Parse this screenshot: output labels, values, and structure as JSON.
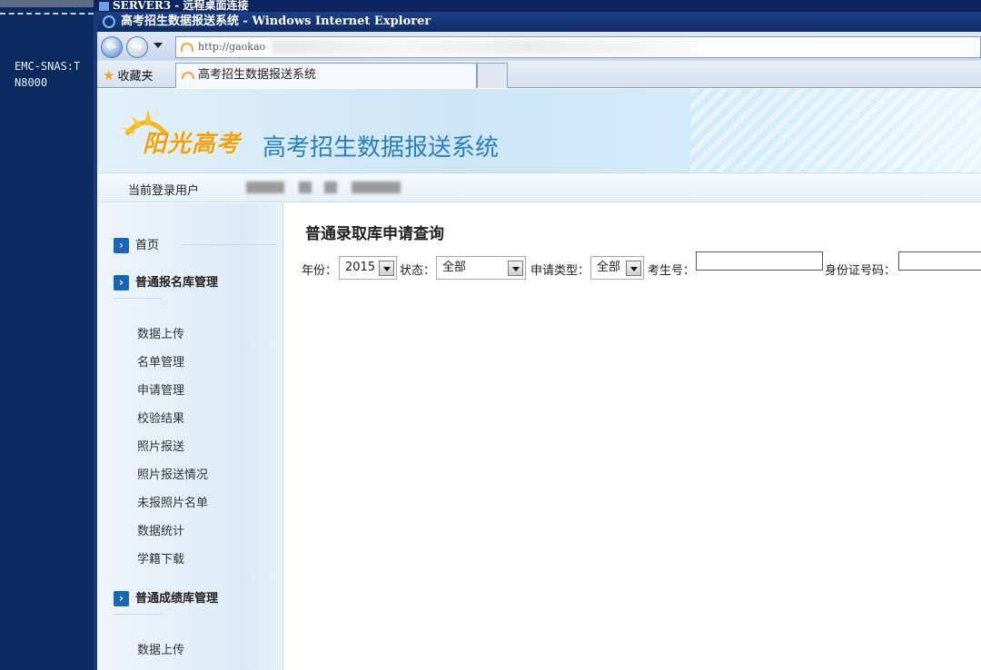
{
  "console": {
    "line1": "EMC-SNAS:T",
    "line2": "N8000"
  },
  "rdp": {
    "title": "SERVER3 - 远程桌面连接"
  },
  "ie": {
    "window_title": "高考招生数据报送系统 - Windows Internet Explorer",
    "address_prefix": "http://gaokao",
    "favorites_label": "收藏夹",
    "tab_title": "高考招生数据报送系统"
  },
  "header": {
    "logo_text": "阳光高考",
    "system_title": "高考招生数据报送系统",
    "current_user_label": "当前登录用户"
  },
  "sidebar": {
    "home": "首页",
    "section1": {
      "title": "普通报名库管理",
      "items": [
        "数据上传",
        "名单管理",
        "申请管理",
        "校验结果",
        "照片报送",
        "照片报送情况",
        "未报照片名单",
        "数据统计",
        "学籍下载"
      ]
    },
    "section2": {
      "title": "普通成绩库管理",
      "items": [
        "数据上传"
      ]
    }
  },
  "main": {
    "title": "普通录取库申请查询",
    "filters": {
      "year_label": "年份：",
      "year_value": "2015",
      "status_label": "状态：",
      "status_value": "全部",
      "apply_type_label": "申请类型：",
      "apply_type_value": "全部",
      "exam_no_label": "考生号：",
      "exam_no_value": "",
      "id_no_label": "身份证号码：",
      "id_no_value": ""
    }
  },
  "colors": {
    "accent": "#1a66b3",
    "title_bar": "#0f2c66",
    "logo": "#f0a010",
    "system_title": "#2b7fc0"
  }
}
